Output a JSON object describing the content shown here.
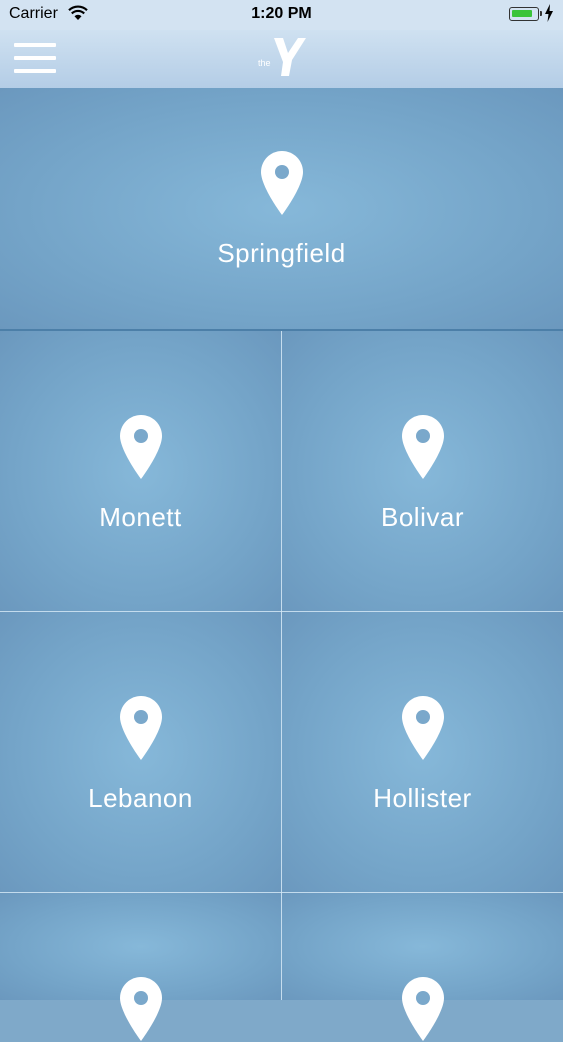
{
  "status_bar": {
    "carrier": "Carrier",
    "time": "1:20 PM",
    "wifi_icon": "wifi-icon",
    "battery_icon": "battery-icon",
    "charging_icon": "bolt-icon"
  },
  "nav": {
    "menu_icon": "hamburger-menu-icon",
    "logo_text": "the"
  },
  "locations": [
    {
      "name": "Springfield",
      "icon": "location-pin-icon"
    },
    {
      "name": "Monett",
      "icon": "location-pin-icon"
    },
    {
      "name": "Bolivar",
      "icon": "location-pin-icon"
    },
    {
      "name": "Lebanon",
      "icon": "location-pin-icon"
    },
    {
      "name": "Hollister",
      "icon": "location-pin-icon"
    }
  ],
  "colors": {
    "tile_background": "#7fa9c9",
    "nav_background": "#c3d8ec",
    "label_text": "#ffffff"
  }
}
